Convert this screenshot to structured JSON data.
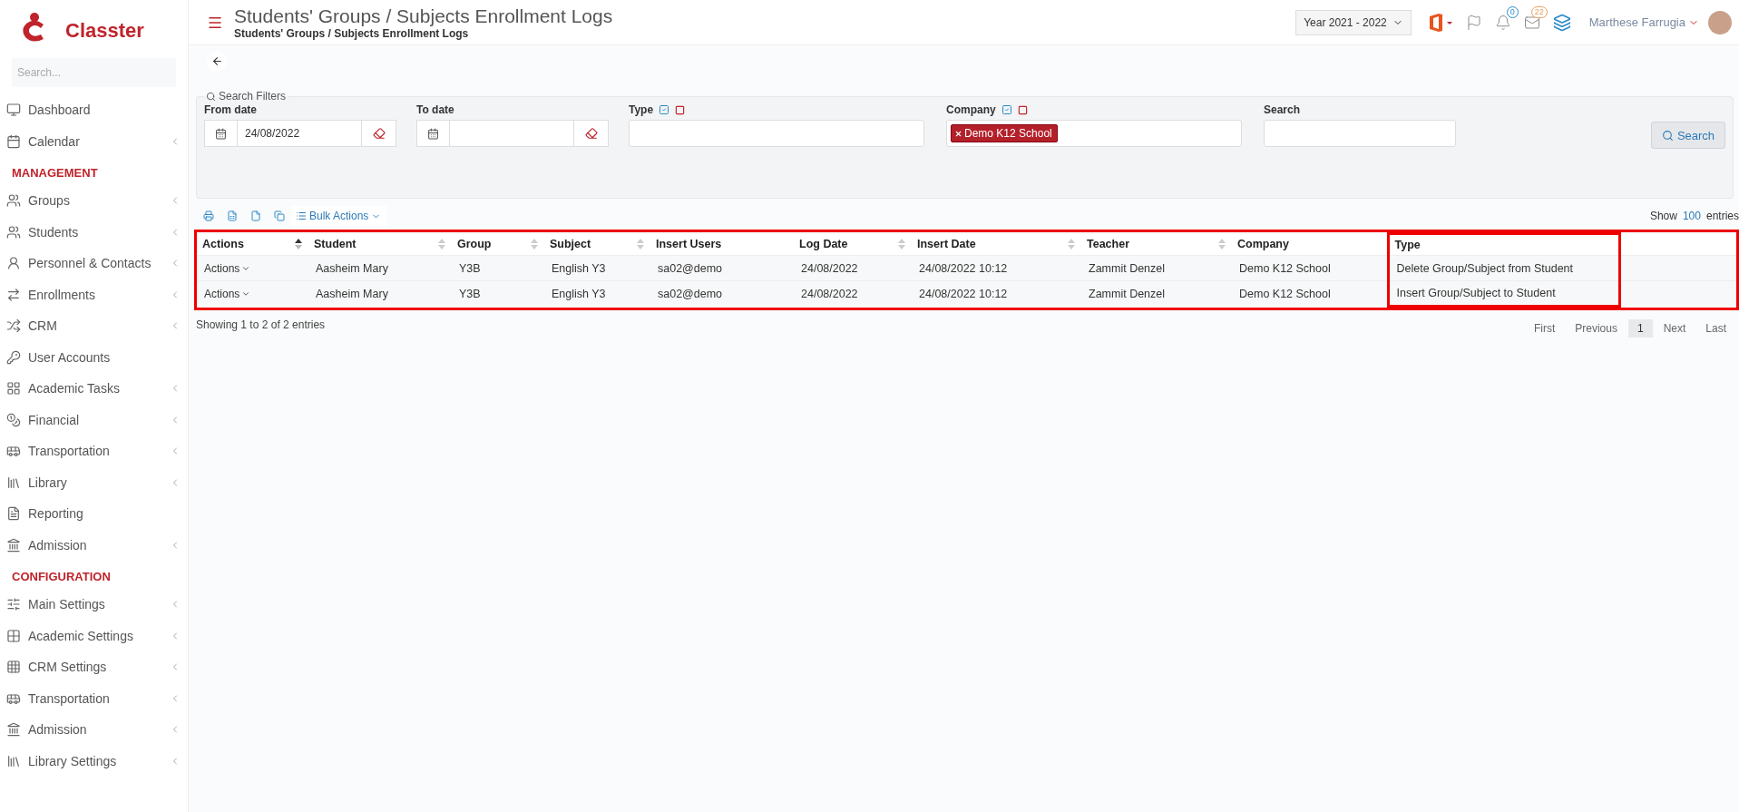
{
  "brand": {
    "name": "Classter"
  },
  "sidebar": {
    "search": {
      "placeholder": "Search..."
    },
    "items": [
      {
        "kind": "link",
        "label": "Dashboard",
        "has_submenu": false
      },
      {
        "kind": "link",
        "label": "Calendar",
        "has_submenu": true
      },
      {
        "kind": "section",
        "label": "MANAGEMENT"
      },
      {
        "kind": "link",
        "label": "Groups",
        "has_submenu": true
      },
      {
        "kind": "link",
        "label": "Students",
        "has_submenu": true
      },
      {
        "kind": "link",
        "label": "Personnel & Contacts",
        "has_submenu": true
      },
      {
        "kind": "link",
        "label": "Enrollments",
        "has_submenu": true
      },
      {
        "kind": "link",
        "label": "CRM",
        "has_submenu": true
      },
      {
        "kind": "link",
        "label": "User Accounts",
        "has_submenu": false
      },
      {
        "kind": "link",
        "label": "Academic Tasks",
        "has_submenu": true
      },
      {
        "kind": "link",
        "label": "Financial",
        "has_submenu": true
      },
      {
        "kind": "link",
        "label": "Transportation",
        "has_submenu": true
      },
      {
        "kind": "link",
        "label": "Library",
        "has_submenu": true
      },
      {
        "kind": "link",
        "label": "Reporting",
        "has_submenu": false
      },
      {
        "kind": "link",
        "label": "Admission",
        "has_submenu": true
      },
      {
        "kind": "section",
        "label": "CONFIGURATION"
      },
      {
        "kind": "link",
        "label": "Main Settings",
        "has_submenu": true
      },
      {
        "kind": "link",
        "label": "Academic Settings",
        "has_submenu": true
      },
      {
        "kind": "link",
        "label": "CRM Settings",
        "has_submenu": true
      },
      {
        "kind": "link",
        "label": "Transportation",
        "has_submenu": true
      },
      {
        "kind": "link",
        "label": "Admission",
        "has_submenu": true
      },
      {
        "kind": "link",
        "label": "Library Settings",
        "has_submenu": true
      }
    ]
  },
  "header": {
    "title": "Students' Groups / Subjects Enrollment Logs",
    "breadcrumb": "Students' Groups / Subjects Enrollment Logs",
    "year": "Year 2021 - 2022",
    "notifications_count": "0",
    "messages_count": "22",
    "user": "Marthese Farrugia"
  },
  "filters": {
    "legend": "Search Filters",
    "fields": [
      {
        "kind": "date",
        "label": "From date",
        "value": "24/08/2022"
      },
      {
        "kind": "date",
        "label": "To date"
      },
      {
        "kind": "multi",
        "label": "Type"
      },
      {
        "kind": "multi",
        "label": "Company",
        "tags": [
          "Demo K12 School"
        ]
      },
      {
        "kind": "text",
        "label": "Search"
      }
    ],
    "button": "Search"
  },
  "toolbar": {
    "bulk_actions": "Bulk Actions",
    "show_label": "Show",
    "page_size": "100",
    "entries_label": "entries"
  },
  "table": {
    "columns": [
      {
        "label": "Actions",
        "sortable": true,
        "sorted": true,
        "highlighted": false
      },
      {
        "label": "Student",
        "sortable": true,
        "sorted": false,
        "highlighted": false
      },
      {
        "label": "Group",
        "sortable": true,
        "sorted": false,
        "highlighted": false
      },
      {
        "label": "Subject",
        "sortable": true,
        "sorted": false,
        "highlighted": false
      },
      {
        "label": "Insert Users",
        "sortable": false,
        "highlighted": false
      },
      {
        "label": "Log Date",
        "sortable": true,
        "sorted": false,
        "highlighted": false
      },
      {
        "label": "Insert Date",
        "sortable": true,
        "sorted": false,
        "highlighted": false
      },
      {
        "label": "Teacher",
        "sortable": true,
        "sorted": false,
        "highlighted": false
      },
      {
        "label": "Company",
        "sortable": false,
        "highlighted": false
      },
      {
        "label": "Type",
        "sortable": false,
        "highlighted": true
      }
    ],
    "rows": [
      [
        "Actions",
        "Aasheim Mary",
        "Y3B",
        "English Y3",
        "sa02@demo",
        "24/08/2022",
        "24/08/2022 10:12",
        "Zammit Denzel",
        "Demo K12 School",
        "Delete Group/Subject from Student"
      ],
      [
        "Actions",
        "Aasheim Mary",
        "Y3B",
        "English Y3",
        "sa02@demo",
        "24/08/2022",
        "24/08/2022 10:12",
        "Zammit Denzel",
        "Demo K12 School",
        "Insert Group/Subject to Student"
      ]
    ],
    "highlighted": true,
    "info": "Showing 1 to 2 of 2 entries"
  },
  "pagination": [
    {
      "label": "First",
      "selected": false
    },
    {
      "label": "Previous",
      "selected": false
    },
    {
      "label": "1",
      "selected": true
    },
    {
      "label": "Next",
      "selected": false
    },
    {
      "label": "Last",
      "selected": false
    }
  ]
}
